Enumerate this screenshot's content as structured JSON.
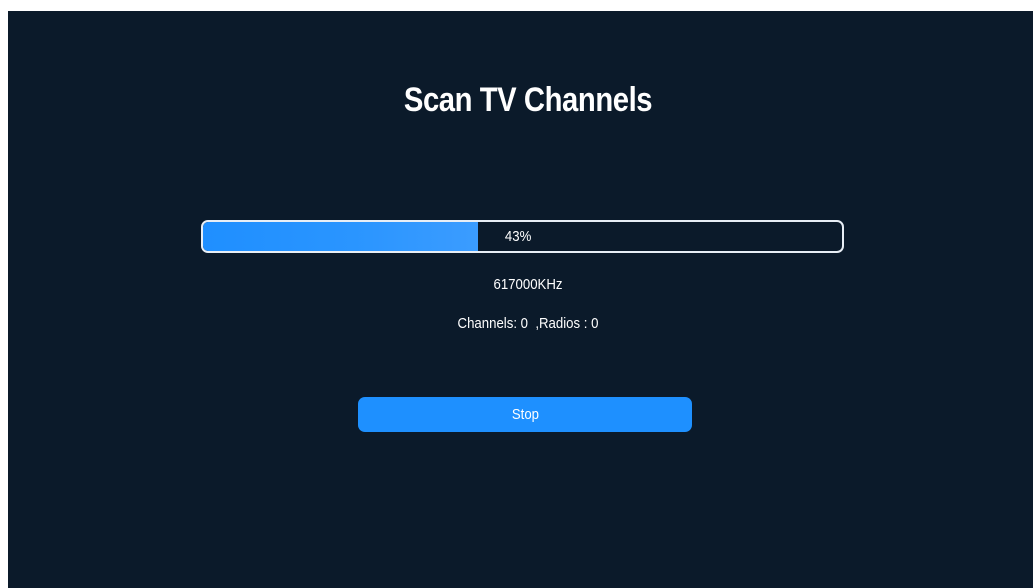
{
  "screen": {
    "title": "Scan TV Channels",
    "progress": {
      "value": 0.43,
      "label": "43%"
    },
    "frequency": "617000KHz",
    "counts": "Channels: 0  ,Radios : 0",
    "stop_label": "Stop",
    "colors": {
      "background": "#0b1a2a",
      "accent": "#1e90ff",
      "text": "#ffffff",
      "progress_border": "#e8eef5"
    }
  }
}
